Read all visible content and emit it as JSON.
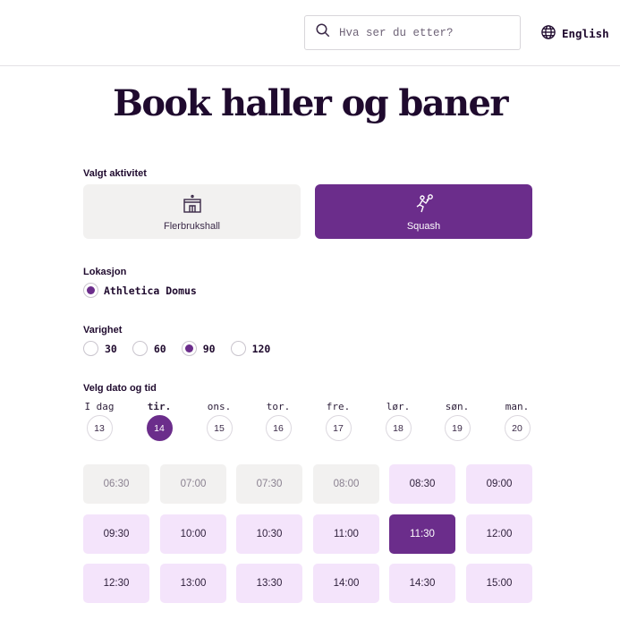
{
  "header": {
    "search_placeholder": "Hva ser du etter?",
    "language_label": "English"
  },
  "page_title": "Book haller og baner",
  "activity": {
    "label": "Valgt aktivitet",
    "options": [
      {
        "name": "Flerbrukshall",
        "icon": "sports-hall-icon",
        "selected": false
      },
      {
        "name": "Squash",
        "icon": "squash-player-icon",
        "selected": true
      }
    ]
  },
  "location": {
    "label": "Lokasjon",
    "selected": "Athletica Domus"
  },
  "duration": {
    "label": "Varighet",
    "options": [
      "30",
      "60",
      "90",
      "120"
    ],
    "selected": "90"
  },
  "date": {
    "label": "Velg dato og tid",
    "days": [
      {
        "name": "I dag",
        "num": "13"
      },
      {
        "name": "tir.",
        "num": "14"
      },
      {
        "name": "ons.",
        "num": "15"
      },
      {
        "name": "tor.",
        "num": "16"
      },
      {
        "name": "fre.",
        "num": "17"
      },
      {
        "name": "lør.",
        "num": "18"
      },
      {
        "name": "søn.",
        "num": "19"
      },
      {
        "name": "man.",
        "num": "20"
      }
    ],
    "selected_index": 1
  },
  "times": {
    "slots": [
      {
        "time": "06:30",
        "state": "unavailable"
      },
      {
        "time": "07:00",
        "state": "unavailable"
      },
      {
        "time": "07:30",
        "state": "unavailable"
      },
      {
        "time": "08:00",
        "state": "unavailable"
      },
      {
        "time": "08:30",
        "state": "available"
      },
      {
        "time": "09:00",
        "state": "available"
      },
      {
        "time": "09:30",
        "state": "available"
      },
      {
        "time": "10:00",
        "state": "available"
      },
      {
        "time": "10:30",
        "state": "available"
      },
      {
        "time": "11:00",
        "state": "available"
      },
      {
        "time": "11:30",
        "state": "selected"
      },
      {
        "time": "12:00",
        "state": "available"
      },
      {
        "time": "12:30",
        "state": "available"
      },
      {
        "time": "13:00",
        "state": "available"
      },
      {
        "time": "13:30",
        "state": "available"
      },
      {
        "time": "14:00",
        "state": "available"
      },
      {
        "time": "14:30",
        "state": "available"
      },
      {
        "time": "15:00",
        "state": "available"
      }
    ]
  },
  "colors": {
    "brand_purple": "#6b2d8b",
    "available_slot": "#f4e4fb",
    "unavailable_slot": "#f2f1f0",
    "text_dark": "#1f0a2e"
  }
}
